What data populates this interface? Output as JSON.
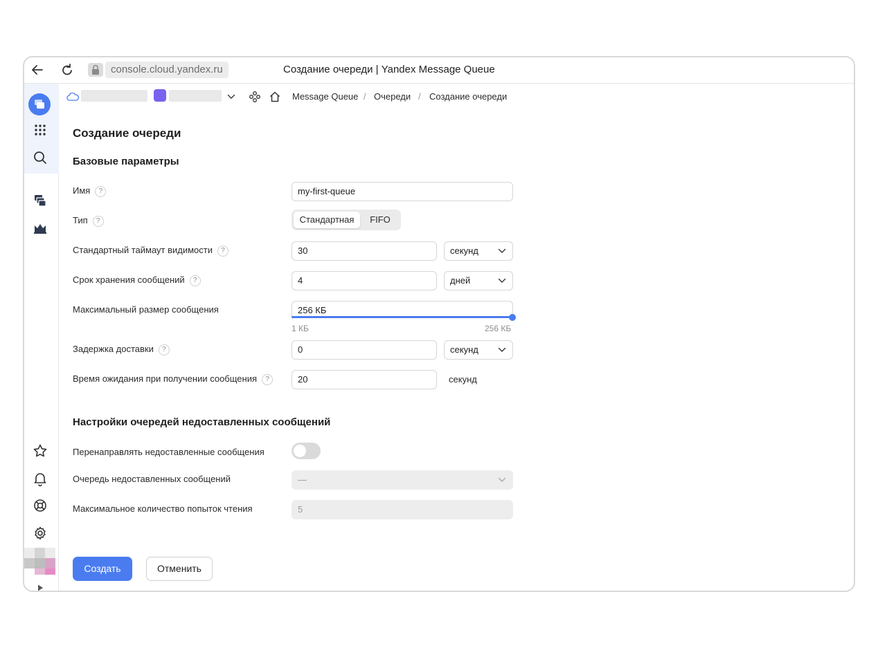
{
  "browser": {
    "url": "console.cloud.yandex.ru",
    "tab_title": "Создание очереди | Yandex Message Queue"
  },
  "breadcrumbs": {
    "items": [
      "Message Queue",
      "Очереди",
      "Создание очереди"
    ],
    "separator": "/"
  },
  "page": {
    "title": "Создание очереди",
    "basic_section": "Базовые параметры",
    "dlq_section": "Настройки очередей недоставленных сообщений"
  },
  "form": {
    "name": {
      "label": "Имя",
      "help": "?",
      "value": "my-first-queue"
    },
    "type": {
      "label": "Тип",
      "help": "?",
      "options": [
        "Стандартная",
        "FIFO"
      ],
      "selected": "Стандартная"
    },
    "visibility_timeout": {
      "label": "Стандартный таймаут видимости",
      "help": "?",
      "value": "30",
      "unit": "секунд"
    },
    "retention": {
      "label": "Срок хранения сообщений",
      "help": "?",
      "value": "4",
      "unit": "дней"
    },
    "max_size": {
      "label": "Максимальный размер сообщения",
      "value": "256 КБ",
      "min_label": "1 КБ",
      "max_label": "256 КБ",
      "level": 1.0
    },
    "delivery_delay": {
      "label": "Задержка доставки",
      "help": "?",
      "value": "0",
      "unit": "секунд"
    },
    "receive_wait": {
      "label": "Время ожидания при получении сообщения",
      "help": "?",
      "value": "20",
      "unit": "секунд"
    },
    "redirect": {
      "label": "Перенаправлять недоставленные сообщения",
      "enabled": false
    },
    "dlq": {
      "label": "Очередь недоставленных сообщений",
      "value": "—"
    },
    "max_receive": {
      "label": "Максимальное количество попыток чтения",
      "value": "5"
    }
  },
  "actions": {
    "create": "Создать",
    "cancel": "Отменить"
  },
  "colors": {
    "accent": "#4a7cf0",
    "sidebar_highlight": "#eef3fc"
  },
  "icons": {
    "back": "arrow-left-icon",
    "reload": "reload-icon",
    "lock": "lock-icon",
    "services": "grid-icon",
    "search": "search-icon",
    "favorites": "star-icon",
    "notifications": "bell-icon",
    "support": "lifebuoy-icon",
    "settings": "gear-icon"
  }
}
